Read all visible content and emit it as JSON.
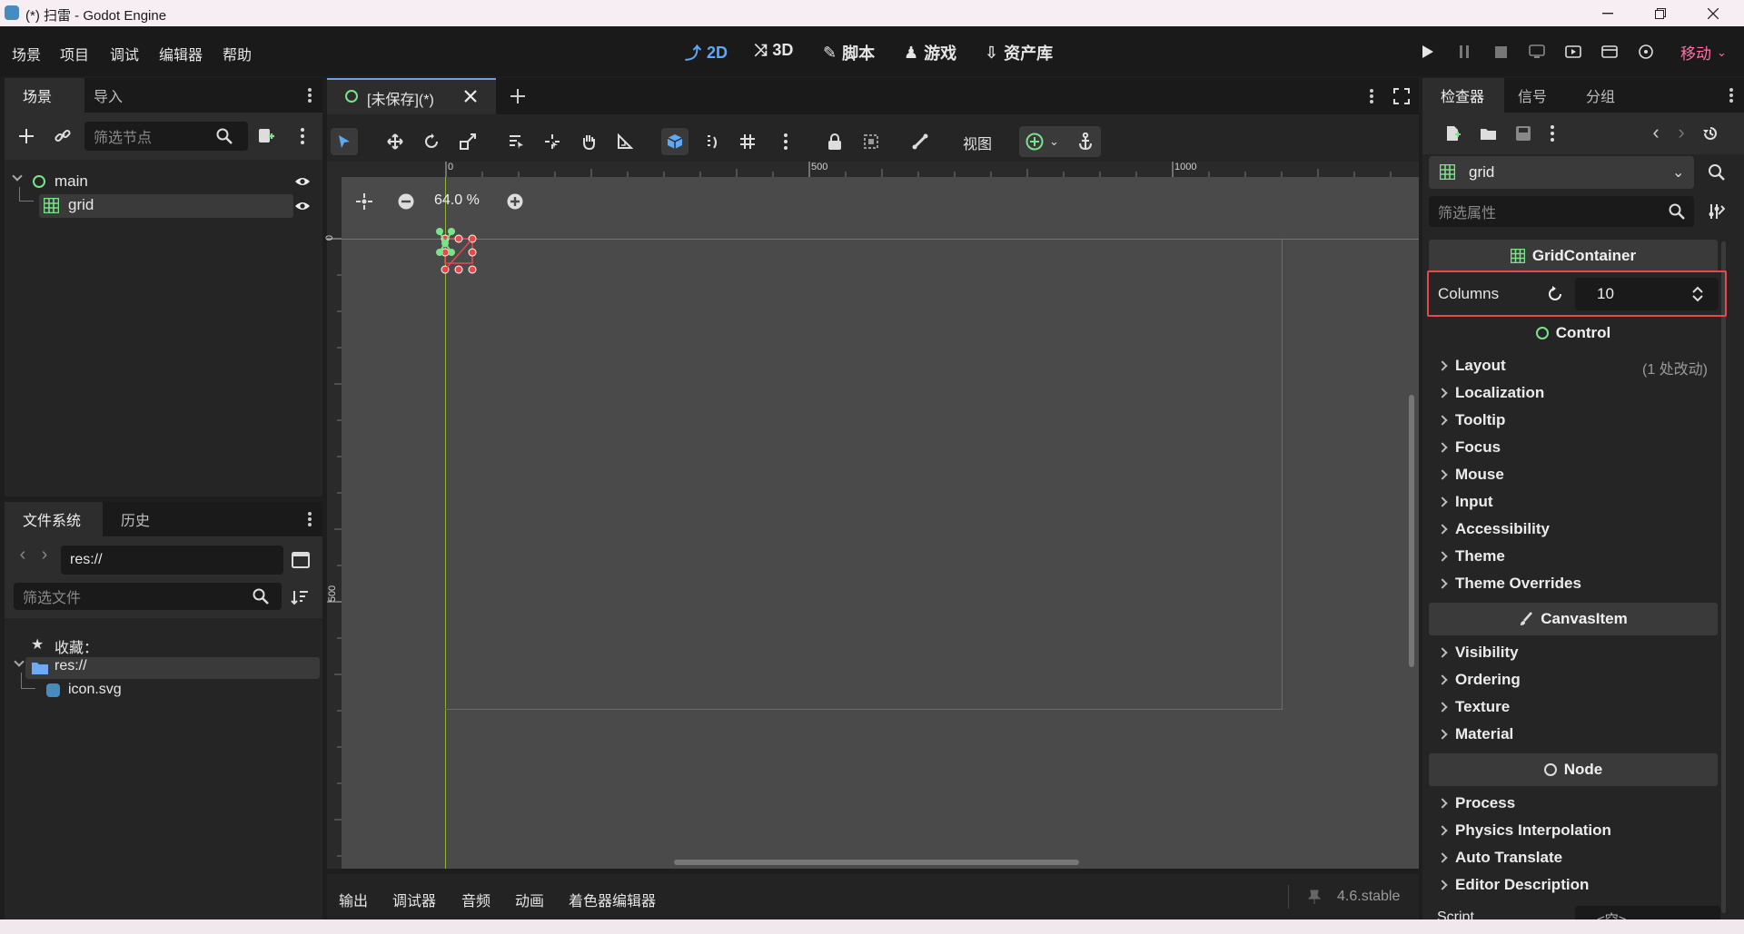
{
  "window": {
    "title": "(*) 扫雷 - Godot Engine"
  },
  "menu": [
    "场景",
    "项目",
    "调试",
    "编辑器",
    "帮助"
  ],
  "workspaces": [
    {
      "label": "2D",
      "active": true
    },
    {
      "label": "3D",
      "active": false
    },
    {
      "label": "脚本",
      "active": false
    },
    {
      "label": "游戏",
      "active": false
    },
    {
      "label": "资产库",
      "active": false
    }
  ],
  "run_mode": "移动",
  "scene_panel": {
    "tabs": [
      "场景",
      "导入"
    ],
    "filter_placeholder": "筛选节点",
    "nodes": [
      {
        "name": "main",
        "type": "control"
      },
      {
        "name": "grid",
        "type": "grid",
        "selected": true
      }
    ]
  },
  "filesystem_panel": {
    "tabs": [
      "文件系统",
      "历史"
    ],
    "path": "res://",
    "filter_placeholder": "筛选文件",
    "favorites_label": "收藏：",
    "root": "res://",
    "files": [
      "icon.svg"
    ]
  },
  "editor": {
    "tab_label": "[未保存](*)",
    "view_label": "视图",
    "zoom": "64.0 %",
    "ruler_marks_h": [
      "0",
      "500",
      "1000"
    ],
    "ruler_marks_v": [
      "0",
      "500"
    ]
  },
  "bottom_panel": {
    "tabs": [
      "输出",
      "调试器",
      "音频",
      "动画",
      "着色器编辑器"
    ],
    "version": "4.6.stable"
  },
  "inspector": {
    "tabs": [
      "检查器",
      "信号",
      "分组"
    ],
    "node_name": "grid",
    "filter_placeholder": "筛选属性",
    "grid_section": "GridContainer",
    "columns_label": "Columns",
    "columns_value": "10",
    "control_section": "Control",
    "control_props": [
      "Layout",
      "Localization",
      "Tooltip",
      "Focus",
      "Mouse",
      "Input",
      "Accessibility",
      "Theme",
      "Theme Overrides"
    ],
    "layout_note": "(1 处改动)",
    "canvasitem_section": "CanvasItem",
    "canvasitem_props": [
      "Visibility",
      "Ordering",
      "Texture",
      "Material"
    ],
    "node_section": "Node",
    "node_props": [
      "Process",
      "Physics Interpolation",
      "Auto Translate",
      "Editor Description"
    ],
    "script_label": "Script",
    "script_value": "<空>"
  },
  "colors": {
    "accent_blue": "#5da9f6",
    "grid_green": "#7be28a",
    "highlight_red": "#e8474c",
    "run_mode_pink": "#ff6fa8"
  }
}
